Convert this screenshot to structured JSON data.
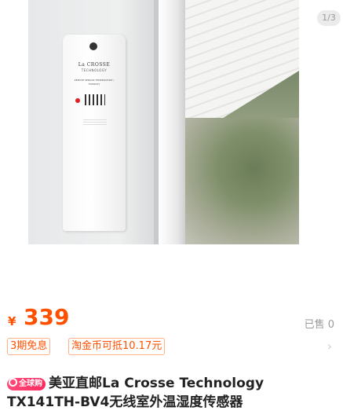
{
  "gallery": {
    "counter": "1/3",
    "device_brand": "La CROSSE",
    "device_brand_sub": "TECHNOLOGY",
    "device_sensor_text": "REMOTE SENSOR TEMPERATURE / HUMIDITY"
  },
  "price": {
    "currency": "¥",
    "value": "339",
    "sold": "已售 0"
  },
  "tags": [
    {
      "label": "3期免息"
    },
    {
      "label": "淘金币可抵10.17元"
    }
  ],
  "title": {
    "badge": "全球购",
    "text": "美亚直邮La Crosse Technology TX141TH-BV4无线室外温湿度传感器"
  },
  "colors": {
    "accent": "#ff5000",
    "badge": "#ff2a5e"
  }
}
